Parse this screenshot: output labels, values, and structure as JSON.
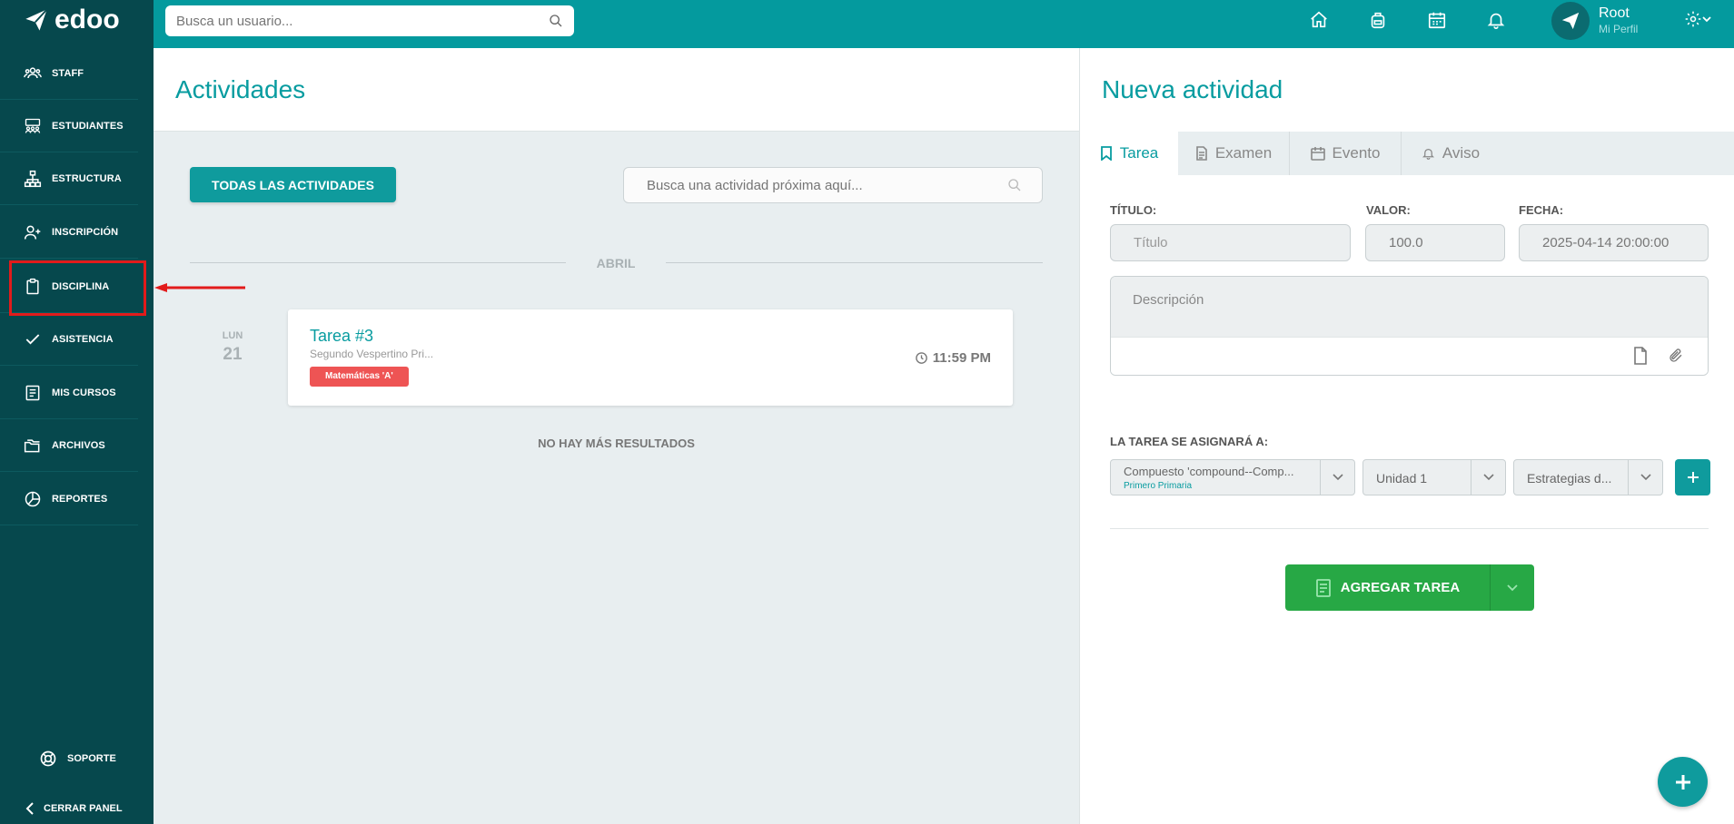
{
  "app": {
    "logo_text": "edoo"
  },
  "topbar": {
    "search_placeholder": "Busca un usuario...",
    "user_name": "Root",
    "user_subtitle": "Mi Perfil"
  },
  "sidebar": {
    "items": [
      {
        "label": "STAFF",
        "icon": "users-icon"
      },
      {
        "label": "ESTUDIANTES",
        "icon": "students-icon"
      },
      {
        "label": "ESTRUCTURA",
        "icon": "structure-icon"
      },
      {
        "label": "INSCRIPCIÓN",
        "icon": "user-plus-icon"
      },
      {
        "label": "DISCIPLINA",
        "icon": "clipboard-icon"
      },
      {
        "label": "ASISTENCIA",
        "icon": "check-icon"
      },
      {
        "label": "MIS CURSOS",
        "icon": "courses-icon"
      },
      {
        "label": "ARCHIVOS",
        "icon": "folders-icon"
      },
      {
        "label": "REPORTES",
        "icon": "pie-chart-icon"
      }
    ],
    "support_label": "SOPORTE",
    "close_label": "CERRAR PANEL"
  },
  "activities": {
    "title": "Actividades",
    "all_button": "TODAS LAS ACTIVIDADES",
    "search_placeholder": "Busca una actividad próxima aquí...",
    "month": "ABRIL",
    "items": [
      {
        "day_name": "LUN",
        "day_num": "21",
        "title": "Tarea #3",
        "subtitle": "Segundo Vespertino Pri...",
        "tag": "Matemáticas 'A'",
        "time": "11:59 PM"
      }
    ],
    "no_more": "NO HAY MÁS RESULTADOS"
  },
  "new_activity": {
    "title": "Nueva actividad",
    "tabs": [
      "Tarea",
      "Examen",
      "Evento",
      "Aviso"
    ],
    "fields": {
      "title_label": "TÍTULO:",
      "title_placeholder": "Título",
      "value_label": "VALOR:",
      "value": "100.0",
      "date_label": "FECHA:",
      "date": "2025-04-14 20:00:00",
      "description_placeholder": "Descripción"
    },
    "assign_label": "LA TAREA SE ASIGNARÁ A:",
    "selects": {
      "course": "Compuesto 'compound--Comp...",
      "course_sub": "Primero Primaria",
      "unit": "Unidad 1",
      "strategy": "Estrategias d..."
    },
    "add_button": "AGREGAR TAREA"
  },
  "colors": {
    "teal": "#049a9e",
    "sidebar": "#06484d",
    "green": "#27a845",
    "tag_red": "#ee5454",
    "highlight_red": "#e21b1b"
  }
}
